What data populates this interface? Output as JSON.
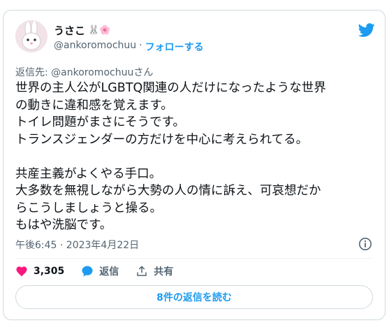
{
  "author": {
    "display_name": "うさこ",
    "name_emojis": "🐰🌸",
    "handle": "@ankoromochuu",
    "separator": "·",
    "follow_label": "フォローする"
  },
  "reply_to": "返信先: @ankoromochuuさん",
  "tweet_text": "世界の主人公がLGBTQ関連の人だけになったような世界\nの動きに違和感を覚えます。\nトイレ問題がまさにそうです。\nトランスジェンダーの方だけを中心に考えられてる。\n\n共産主義がよくやる手口。\n大多数を無視しながら大勢の人の情に訴え、可哀想だか\nらこうしましょうと操る。\nもはや洗脳です。",
  "timestamp": "午後6:45 · 2023年4月22日",
  "actions": {
    "like_count": "3,305",
    "reply_label": "返信",
    "share_label": "共有"
  },
  "read_replies_label": "8件の返信を読む",
  "colors": {
    "accent": "#1d9bf0",
    "like": "#f91880",
    "muted": "#536471"
  },
  "icons": [
    "twitter-bird-icon",
    "info-icon",
    "heart-icon",
    "reply-bubble-icon",
    "share-icon"
  ]
}
